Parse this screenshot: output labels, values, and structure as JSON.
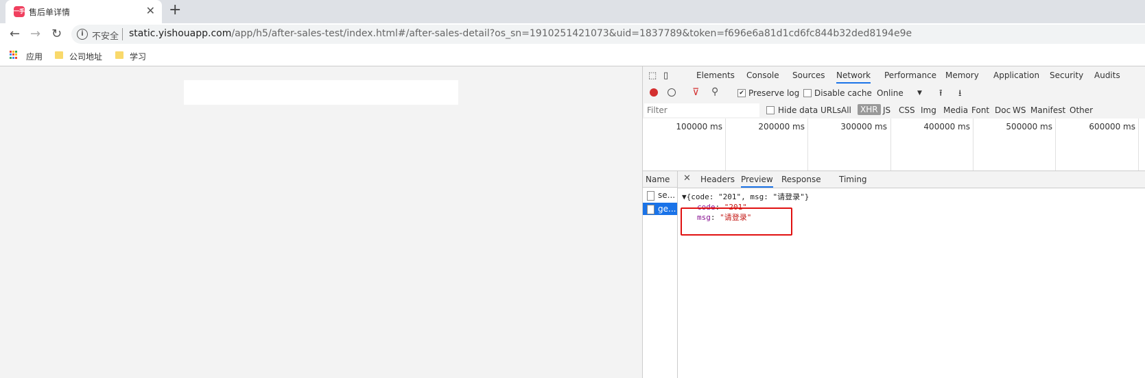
{
  "browser": {
    "tab_title": "售后单详情",
    "favicon_text": "一手",
    "tab_close": "✕",
    "new_tab": "+",
    "nav": {
      "back": "←",
      "forward": "→",
      "reload": "↻"
    },
    "security_label": "不安全",
    "url_host": "static.yishouapp.com",
    "url_path": "/app/h5/after-sales-test/index.html#/after-sales-detail?os_sn=1910251421073&uid=1837789&token=f696e6a81d1cd6fc844b32ded8194e9e",
    "bookmarks": [
      "应用",
      "公司地址",
      "学习"
    ]
  },
  "devtools": {
    "tabs": [
      "Elements",
      "Console",
      "Sources",
      "Network",
      "Performance",
      "Memory",
      "Application",
      "Security",
      "Audits"
    ],
    "active_tab": "Network",
    "toolbar": {
      "preserve_log": "Preserve log",
      "preserve_log_checked": true,
      "disable_cache": "Disable cache",
      "throttle": "Online"
    },
    "filter": {
      "placeholder": "Filter",
      "hide_data_urls": "Hide data URLs",
      "types": [
        "All",
        "XHR",
        "JS",
        "CSS",
        "Img",
        "Media",
        "Font",
        "Doc",
        "WS",
        "Manifest",
        "Other"
      ],
      "active_type": "XHR"
    },
    "timeline_ticks": [
      "100000 ms",
      "200000 ms",
      "300000 ms",
      "400000 ms",
      "500000 ms",
      "600000 ms"
    ],
    "name_header": "Name",
    "requests": [
      {
        "name": "se...",
        "selected": false
      },
      {
        "name": "ge...",
        "selected": true
      }
    ],
    "detail_tabs": [
      "Headers",
      "Preview",
      "Response",
      "Timing"
    ],
    "active_detail_tab": "Preview",
    "preview": {
      "summary": "▼{code: \"201\", msg: \"请登录\"}",
      "code_key": "code",
      "code_val": "\"201\"",
      "msg_key": "msg",
      "msg_val": "\"请登录\""
    }
  },
  "colors": {
    "highlight_box": "#e01010",
    "accent": "#1a73e8",
    "record": "#d32f2f"
  }
}
